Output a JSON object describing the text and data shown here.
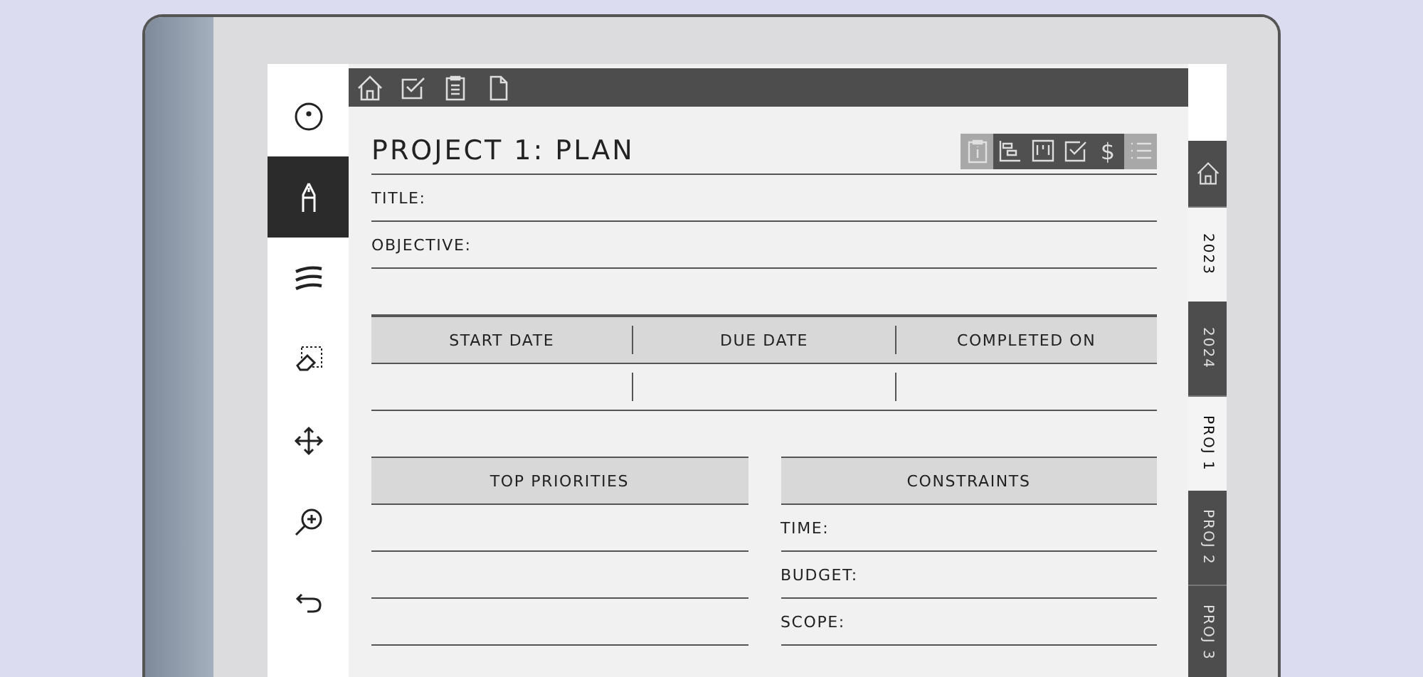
{
  "toolbar": {
    "tools": [
      {
        "kind": "pointer",
        "selected": false
      },
      {
        "kind": "pen",
        "selected": true
      },
      {
        "kind": "stroke",
        "selected": false
      },
      {
        "kind": "eraser",
        "selected": false
      },
      {
        "kind": "move",
        "selected": false
      },
      {
        "kind": "zoom",
        "selected": false
      },
      {
        "kind": "undo",
        "selected": false
      }
    ]
  },
  "nav_bar": {
    "icons": [
      {
        "kind": "home"
      },
      {
        "kind": "check"
      },
      {
        "kind": "clipboard"
      },
      {
        "kind": "document"
      }
    ]
  },
  "page": {
    "title": "PROJECT 1: PLAN",
    "view_buttons": [
      {
        "kind": "info",
        "enabled": false
      },
      {
        "kind": "gantt",
        "enabled": true
      },
      {
        "kind": "kanban",
        "enabled": true
      },
      {
        "kind": "check",
        "enabled": true
      },
      {
        "kind": "text",
        "glyph": "$",
        "enabled": true
      },
      {
        "kind": "list",
        "enabled": false
      }
    ],
    "fields": [
      "TITLE:",
      "OBJECTIVE:"
    ],
    "dates": {
      "columns": [
        "START DATE",
        "DUE DATE",
        "COMPLETED ON"
      ]
    },
    "priorities": {
      "heading": "TOP PRIORITIES"
    },
    "constraints": {
      "heading": "CONSTRAINTS",
      "fields": [
        "TIME:",
        "BUDGET:",
        "SCOPE:"
      ]
    }
  },
  "side_tabs": [
    {
      "kind": "home",
      "selected": false
    },
    {
      "kind": "text",
      "label": "2023",
      "selected": true
    },
    {
      "kind": "text",
      "label": "2024",
      "selected": false
    },
    {
      "kind": "text",
      "label": "PROJ 1",
      "selected": true
    },
    {
      "kind": "text",
      "label": "PROJ 2",
      "selected": false
    },
    {
      "kind": "text",
      "label": "PROJ 3",
      "selected": false
    }
  ]
}
